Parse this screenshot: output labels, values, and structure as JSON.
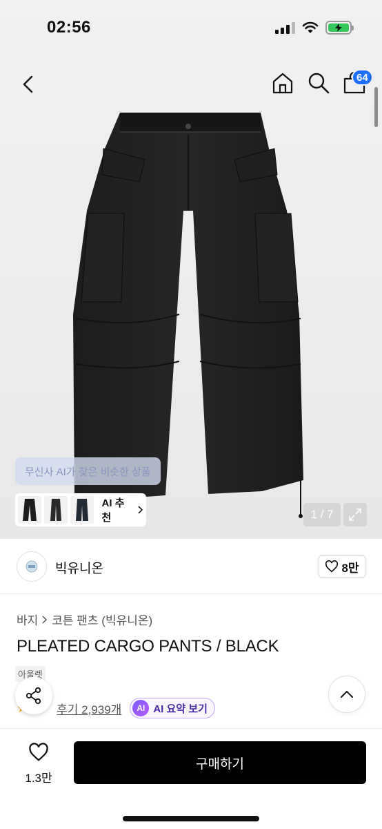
{
  "status": {
    "time": "02:56"
  },
  "nav": {
    "cart_count": "64"
  },
  "gallery": {
    "ai_similar_label": "무신사 AI가 찾은 비슷한 상품",
    "ai_recommend_label": "AI 추천",
    "counter": "1 / 7"
  },
  "brand": {
    "name": "빅유니온",
    "likes": "8만"
  },
  "breadcrumb": {
    "category": "바지",
    "subcategory": "코튼 팬츠 (빅유니온)"
  },
  "product": {
    "title": "PLEATED CARGO PANTS / BLACK",
    "tag": "아울렛",
    "reviews": "후기 2,939개",
    "ai_summary": "AI 요약 보기",
    "ai_badge": "AI"
  },
  "bottom": {
    "wish_count": "1.3만",
    "buy_label": "구매하기"
  },
  "colors": {
    "accent": "#1f6fff",
    "buy": "#000000",
    "ai": "#7a5cff",
    "battery": "#34c759"
  },
  "icons": [
    "back-icon",
    "home-icon",
    "search-icon",
    "cart-icon",
    "share-icon",
    "heart-icon",
    "chevron-up-icon",
    "expand-icon",
    "chevron-right-icon"
  ]
}
